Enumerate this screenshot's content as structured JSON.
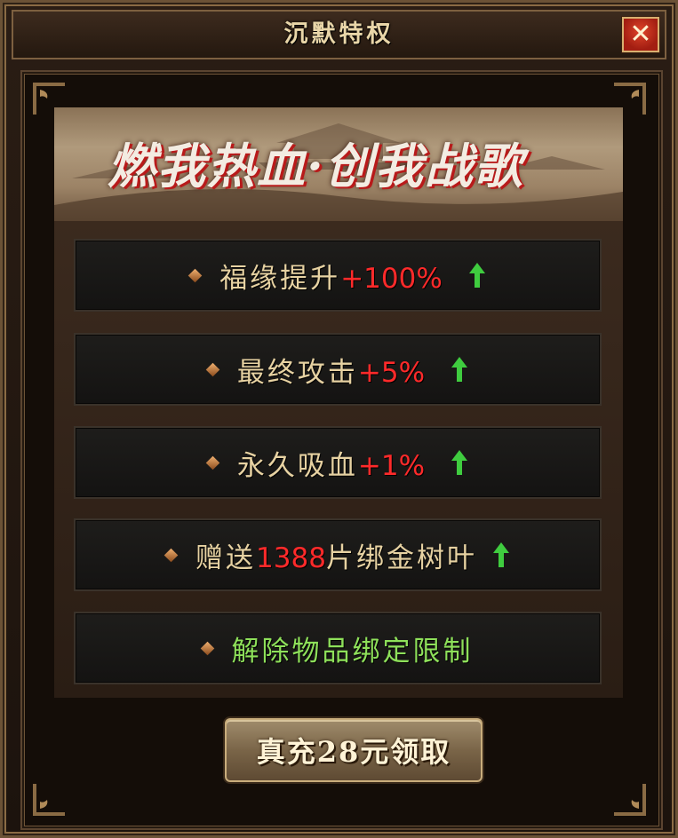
{
  "window": {
    "title": "沉默特权",
    "close_label": "✕"
  },
  "banner": {
    "slogan": "燃我热血·创我战歌"
  },
  "perks": [
    {
      "prefix": "福缘提升",
      "highlight": "+100%",
      "suffix": "",
      "arrow": true,
      "color": "gold"
    },
    {
      "prefix": "最终攻击",
      "highlight": "+5%",
      "suffix": "",
      "arrow": true,
      "color": "gold"
    },
    {
      "prefix": "永久吸血",
      "highlight": "+1%",
      "suffix": "",
      "arrow": true,
      "color": "gold"
    },
    {
      "prefix": "赠送",
      "highlight": "1388",
      "suffix": "片绑金树叶",
      "arrow": true,
      "color": "gold"
    },
    {
      "prefix": "解除物品绑定限制",
      "highlight": "",
      "suffix": "",
      "arrow": false,
      "color": "green"
    }
  ],
  "claim_button": {
    "label": "真充28元领取"
  },
  "colors": {
    "text_gold": "#e7d2a2",
    "highlight_red": "#ff2a2a",
    "text_green": "#8ee05a",
    "arrow_green": "#3fcc3f",
    "close_red": "#c2301c"
  }
}
